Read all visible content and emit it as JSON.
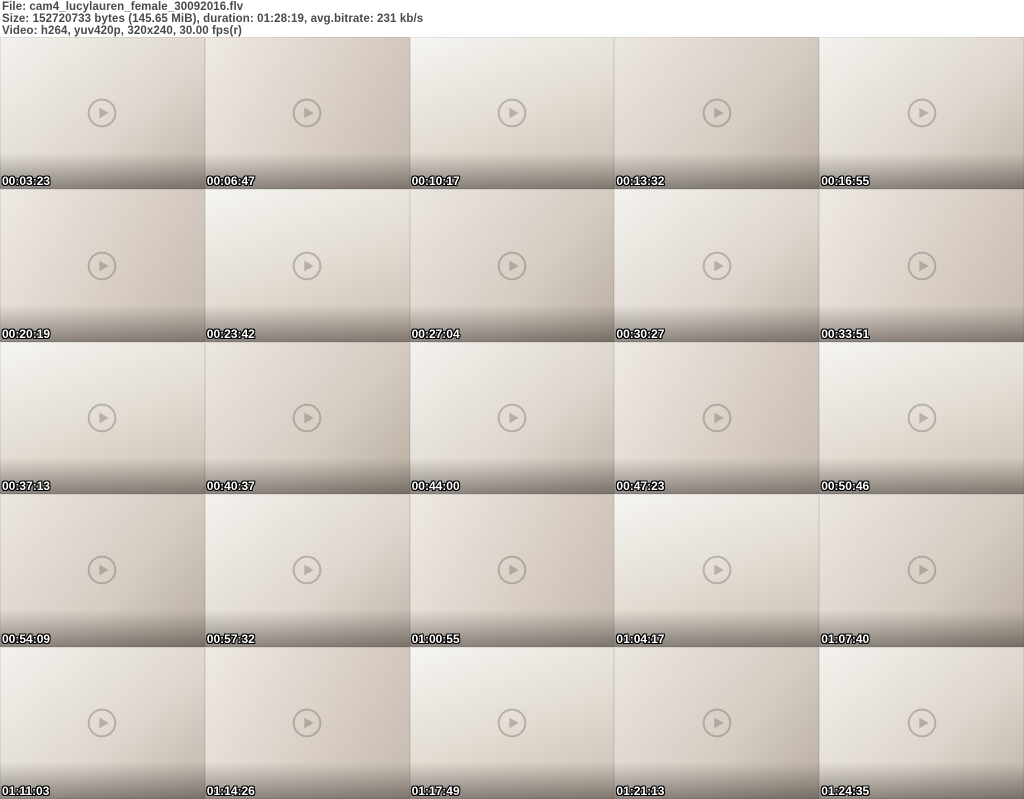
{
  "header": {
    "file_line": "File: cam4_lucylauren_female_30092016.flv",
    "size_line": "Size: 152720733 bytes (145.65 MiB), duration: 01:28:19, avg.bitrate: 231 kb/s",
    "video_line": "Video: h264, yuv420p, 320x240, 30.00 fps(r)"
  },
  "colors": {
    "header_text": "#4a4a4a",
    "background": "#ffffff",
    "timestamp_text": "#ffffff",
    "timestamp_outline": "#000000"
  },
  "grid": {
    "columns": 5,
    "rows": 5,
    "thumbnails": [
      {
        "time": "00:03:23"
      },
      {
        "time": "00:06:47"
      },
      {
        "time": "00:10:17"
      },
      {
        "time": "00:13:32"
      },
      {
        "time": "00:16:55"
      },
      {
        "time": "00:20:19"
      },
      {
        "time": "00:23:42"
      },
      {
        "time": "00:27:04"
      },
      {
        "time": "00:30:27"
      },
      {
        "time": "00:33:51"
      },
      {
        "time": "00:37:13"
      },
      {
        "time": "00:40:37"
      },
      {
        "time": "00:44:00"
      },
      {
        "time": "00:47:23"
      },
      {
        "time": "00:50:46"
      },
      {
        "time": "00:54:09"
      },
      {
        "time": "00:57:32"
      },
      {
        "time": "01:00:55"
      },
      {
        "time": "01:04:17"
      },
      {
        "time": "01:07:40"
      },
      {
        "time": "01:11:03"
      },
      {
        "time": "01:14:26"
      },
      {
        "time": "01:17:49"
      },
      {
        "time": "01:21:13"
      },
      {
        "time": "01:24:35"
      }
    ]
  }
}
